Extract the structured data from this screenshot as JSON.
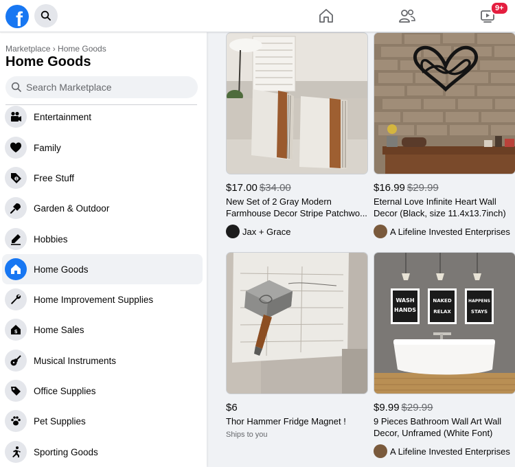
{
  "header": {
    "logo": "f",
    "icons": [
      "search-icon",
      "home-icon",
      "friends-icon",
      "watch-icon"
    ],
    "watch_badge": "9+"
  },
  "sidebar": {
    "breadcrumb": "Marketplace › Home Goods",
    "title": "Home Goods",
    "search_placeholder": "Search Marketplace",
    "categories": [
      {
        "label": "Entertainment",
        "icon": "entertainment-icon"
      },
      {
        "label": "Family",
        "icon": "heart-icon"
      },
      {
        "label": "Free Stuff",
        "icon": "free-tag-icon"
      },
      {
        "label": "Garden & Outdoor",
        "icon": "shovel-icon"
      },
      {
        "label": "Hobbies",
        "icon": "pencil-icon"
      },
      {
        "label": "Home Goods",
        "icon": "home-icon",
        "active": true
      },
      {
        "label": "Home Improvement Supplies",
        "icon": "wrench-icon"
      },
      {
        "label": "Home Sales",
        "icon": "house-sale-icon"
      },
      {
        "label": "Musical Instruments",
        "icon": "guitar-icon"
      },
      {
        "label": "Office Supplies",
        "icon": "tag-icon"
      },
      {
        "label": "Pet Supplies",
        "icon": "paw-icon"
      },
      {
        "label": "Sporting Goods",
        "icon": "running-icon"
      }
    ]
  },
  "listings": [
    {
      "price": "$17.00",
      "old_price": "$34.00",
      "title": "New Set of 2 Gray Modern Farmhouse Decor Stripe Patchwo...",
      "seller": "Jax + Grace",
      "image": "pillows-photo"
    },
    {
      "price": "$16.99",
      "old_price": "$29.99",
      "title": "Eternal Love Infinite Heart Wall Decor (Black, size 11.4x13.7inch)",
      "seller": "A Lifeline Invested Enterprises",
      "image": "heart-wall-decor-photo"
    },
    {
      "price": "$6",
      "old_price": "",
      "title": "Thor Hammer Fridge Magnet !",
      "subtitle": "Ships to you",
      "image": "hammer-magnet-photo"
    },
    {
      "price": "$9.99",
      "old_price": "$29.99",
      "title": "9 Pieces Bathroom Wall Art Wall Decor, Unframed (White Font)",
      "seller": "A Lifeline Invested Enterprises",
      "image": "bathroom-art-photo",
      "poster_texts": [
        "WASH YOUR HANDS",
        "GET NAKED AND RELAX",
        "WHAT HAPPENS STAYS"
      ]
    }
  ],
  "colors": {
    "brand": "#1877f2",
    "badge": "#e41e3f",
    "secondary_text": "#65676b",
    "surface": "#f0f2f5"
  }
}
